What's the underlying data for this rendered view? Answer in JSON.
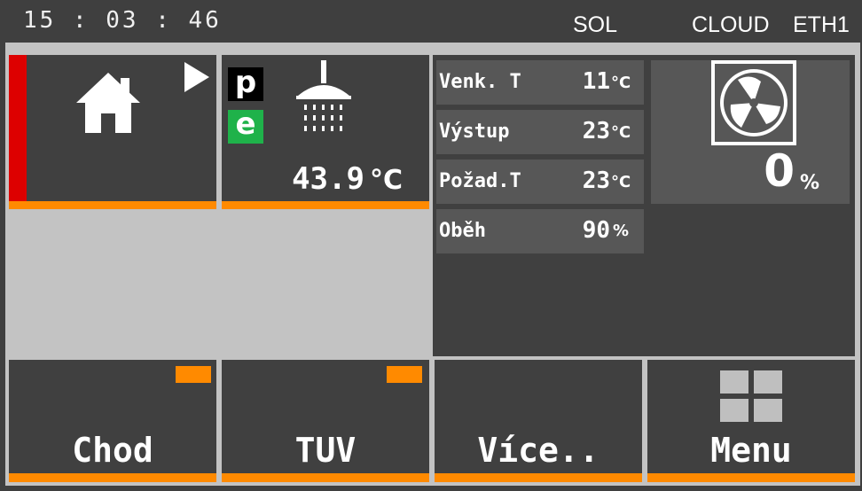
{
  "header": {
    "clock": "15 : 03 : 46",
    "status_sol": "SOL",
    "status_cloud": "CLOUD",
    "status_eth": "ETH1"
  },
  "heating_tile": {
    "icon": "house-icon",
    "arrow_icon": "play-arrow-icon"
  },
  "dhw_tile": {
    "badge_p": "p",
    "badge_e": "e",
    "temperature": "43.9",
    "unit": "°C",
    "icon": "shower-icon"
  },
  "readings": [
    {
      "name": "Venk. T",
      "value": "11",
      "unit": "°C"
    },
    {
      "name": "Výstup",
      "value": "23",
      "unit": "°C"
    },
    {
      "name": "Požad.T",
      "value": "23",
      "unit": "°C"
    },
    {
      "name": "Oběh",
      "value": "90",
      "unit": "%"
    }
  ],
  "fan": {
    "icon": "fan-icon",
    "value": "0",
    "unit": "%"
  },
  "buttons": {
    "chod": "Chod",
    "tuv": "TUV",
    "vice": "Více..",
    "menu": "Menu"
  },
  "colors": {
    "accent": "#ff8a00",
    "alert": "#dd0000",
    "eco": "#1fb24a"
  }
}
